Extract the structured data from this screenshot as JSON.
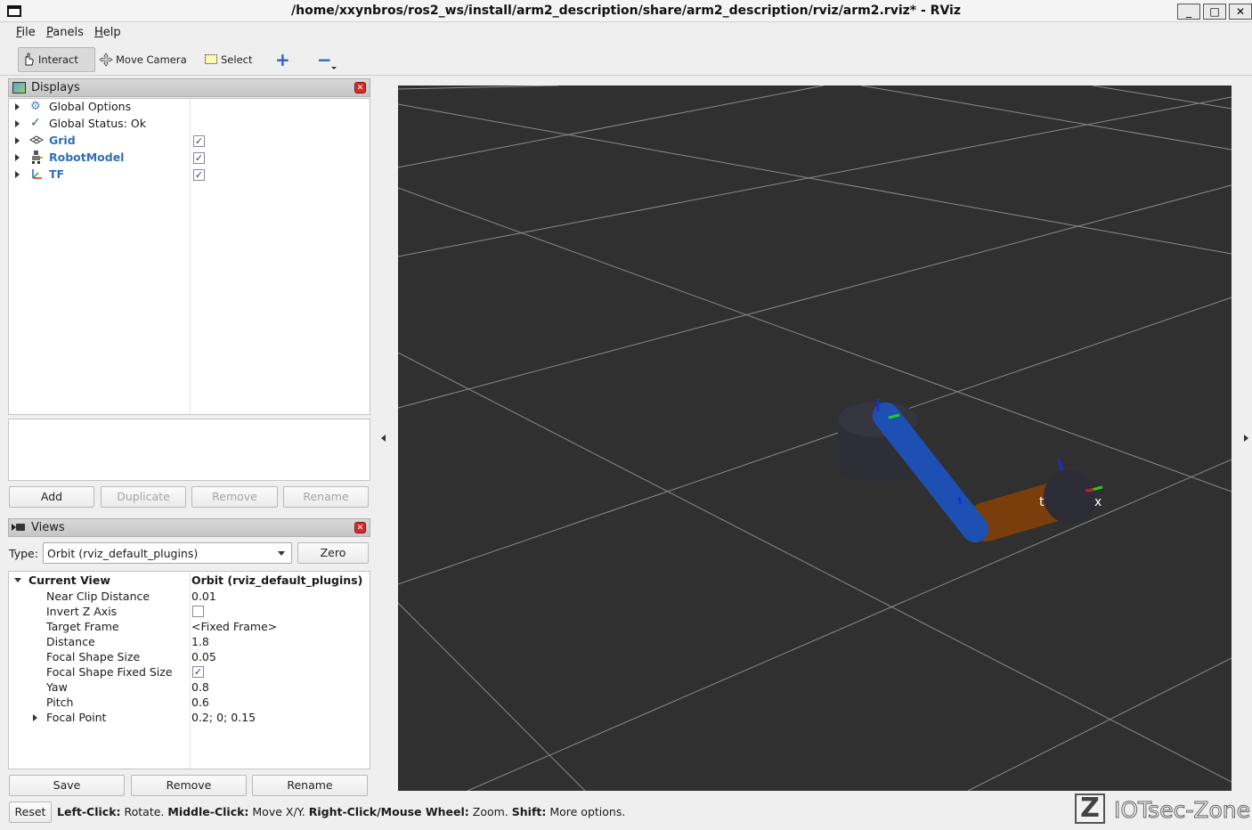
{
  "window": {
    "title": "/home/xxynbros/ros2_ws/install/arm2_description/share/arm2_description/rviz/arm2.rviz* - RViz",
    "minimize": "_",
    "maximize": "□",
    "close": "✕"
  },
  "menu": [
    "File",
    "Panels",
    "Help"
  ],
  "toolbar": {
    "interact": "Interact",
    "move_camera": "Move Camera",
    "select": "Select",
    "plus": "+",
    "minus": "−"
  },
  "displays": {
    "title": "Displays",
    "items": [
      {
        "label": "Global Options",
        "icon": "gear-icon",
        "checked": null
      },
      {
        "label": "Global Status: Ok",
        "icon": "check-icon",
        "checked": null
      },
      {
        "label": "Grid",
        "icon": "grid-icon",
        "checked": true
      },
      {
        "label": "RobotModel",
        "icon": "robot-icon",
        "checked": true
      },
      {
        "label": "TF",
        "icon": "axes-icon",
        "checked": true
      }
    ],
    "buttons": {
      "add": "Add",
      "duplicate": "Duplicate",
      "remove": "Remove",
      "rename": "Rename"
    }
  },
  "views": {
    "title": "Views",
    "type_label": "Type:",
    "type_value": "Orbit (rviz_default_plugins)",
    "zero": "Zero",
    "current_view": {
      "label": "Current View",
      "value": "Orbit (rviz_default_plugins)"
    },
    "properties": [
      {
        "label": "Near Clip Distance",
        "value": "0.01"
      },
      {
        "label": "Invert Z Axis",
        "value": "",
        "checkbox": false
      },
      {
        "label": "Target Frame",
        "value": "<Fixed Frame>"
      },
      {
        "label": "Distance",
        "value": "1.8"
      },
      {
        "label": "Focal Shape Size",
        "value": "0.05"
      },
      {
        "label": "Focal Shape Fixed Size",
        "value": "",
        "checkbox": true
      },
      {
        "label": "Yaw",
        "value": "0.8"
      },
      {
        "label": "Pitch",
        "value": "0.6"
      },
      {
        "label": "Focal Point",
        "value": "0.2; 0; 0.15",
        "expandable": true
      }
    ],
    "buttons": {
      "save": "Save",
      "remove": "Remove",
      "rename": "Rename"
    }
  },
  "status_bar": {
    "reset": "Reset",
    "parts": [
      {
        "bold": "Left-Click:",
        "text": " Rotate. "
      },
      {
        "bold": "Middle-Click:",
        "text": " Move X/Y. "
      },
      {
        "bold": "Right-Click/Mouse Wheel:",
        "text": " Zoom. "
      },
      {
        "bold": "Shift:",
        "text": " More options."
      }
    ]
  },
  "viewport": {
    "labels": {
      "left": "t",
      "right": "x"
    },
    "colors": {
      "background": "#303030",
      "grid": "#8a8a8a",
      "link1": "#1e50b4",
      "link2": "#7a3e0c",
      "base": "#2e2e36"
    }
  },
  "watermark": {
    "letter": "Z",
    "text": "IOTsec-Zone"
  }
}
